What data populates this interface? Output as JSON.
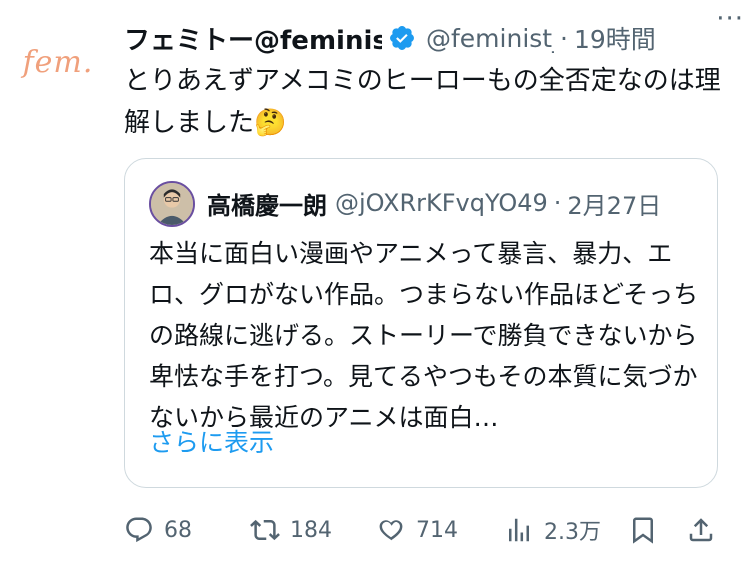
{
  "tweet": {
    "avatar_text": "fem.",
    "display_name": "フェミトー@feminis",
    "handle": "@feminist_",
    "separator": "·",
    "time": "19時間",
    "more": "···",
    "text": "とりあえずアメコミのヒーローもの全否定なのは理解しました🤔"
  },
  "quote": {
    "name": "高橋慶一朗",
    "handle": "@jOXRrKFvqYO49",
    "separator": "·",
    "date": "2月27日",
    "text": "本当に面白い漫画やアニメって暴言、暴力、エロ、グロがない作品。つまらない作品ほどそっちの路線に逃げる。ストーリーで勝負できないから卑怯な手を打つ。見てるやつもその本質に気づかないから最近のアニメは面白…",
    "show_more": "さらに表示"
  },
  "actions": {
    "replies": "68",
    "reposts": "184",
    "likes": "714",
    "views": "2.3万"
  },
  "colors": {
    "text": "#0f1419",
    "muted": "#536471",
    "link": "#1d9bf0",
    "border": "#cfd9de",
    "logo": "#f0a07c"
  },
  "icons": [
    "verified-badge-icon",
    "more-icon",
    "reply-icon",
    "repost-icon",
    "like-icon",
    "views-icon",
    "bookmark-icon",
    "share-icon"
  ]
}
